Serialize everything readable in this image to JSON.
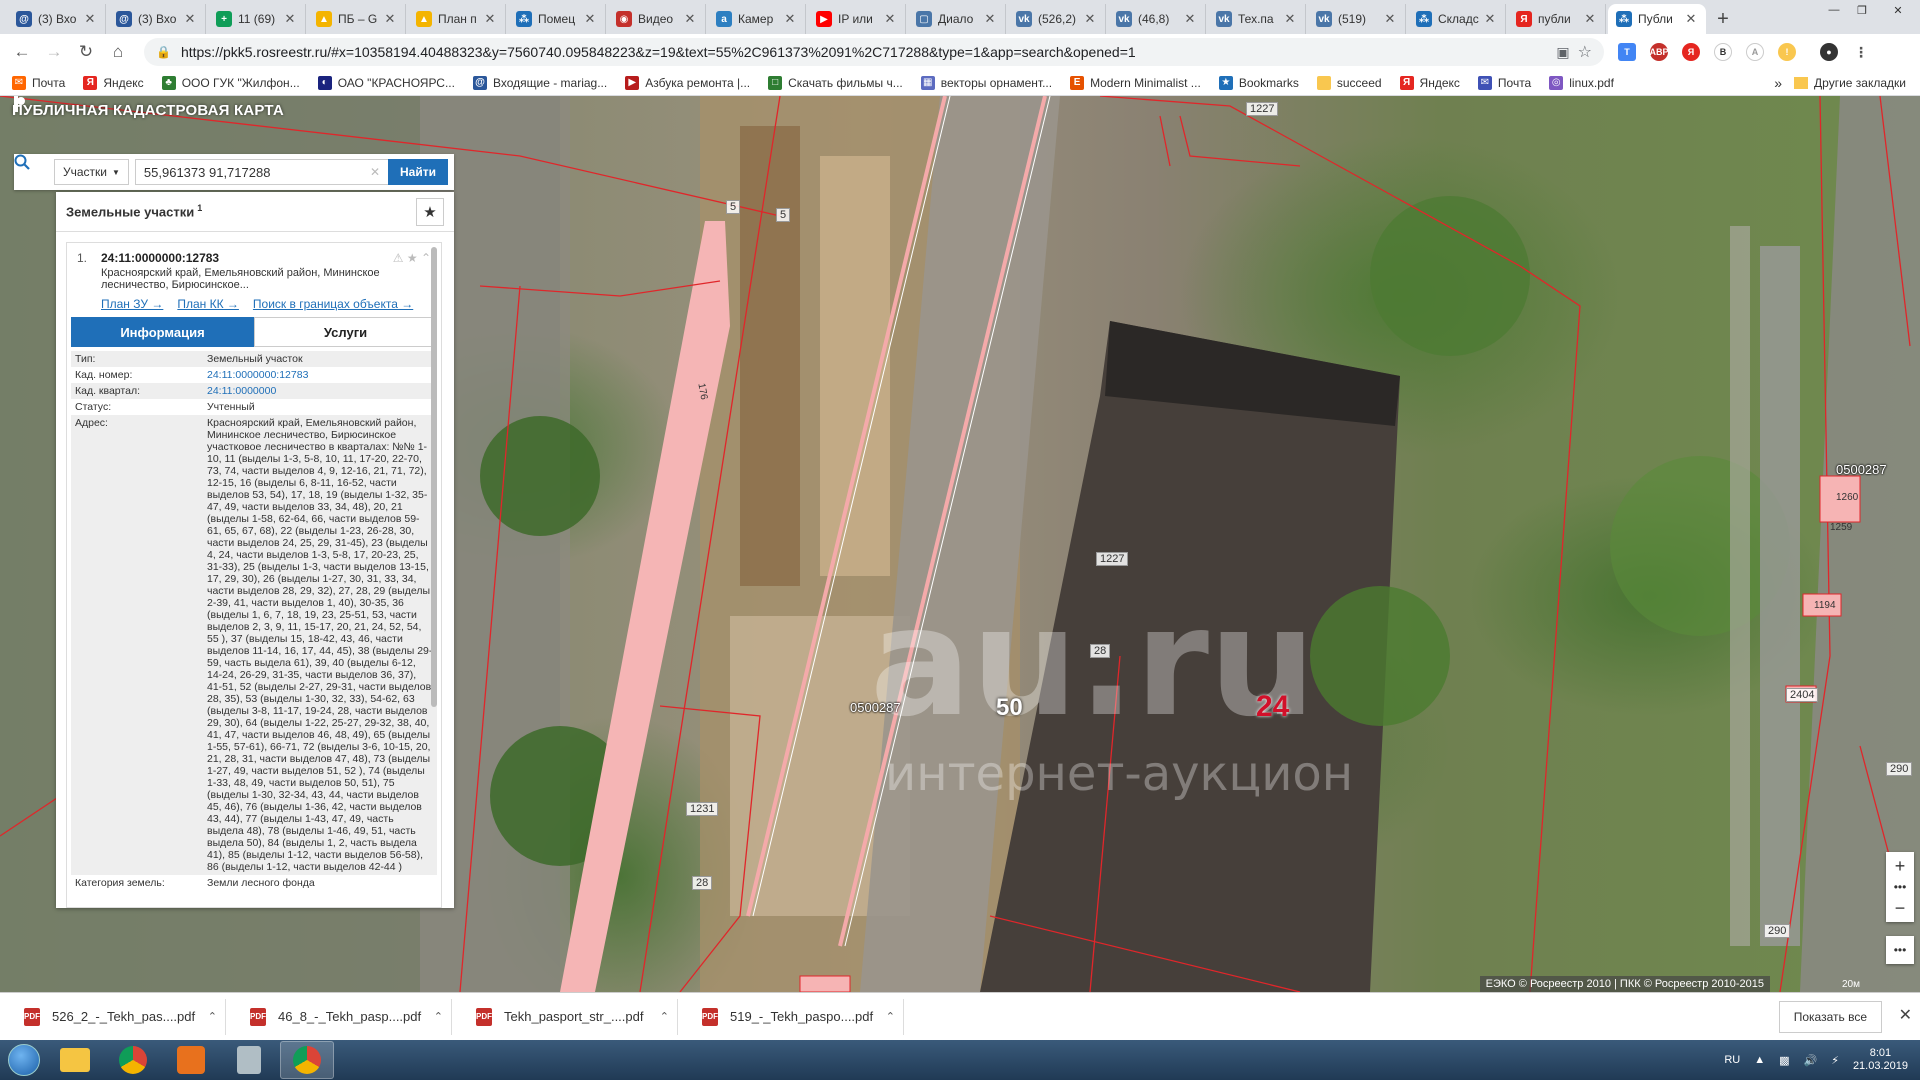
{
  "browser": {
    "tabs": [
      {
        "label": "(3) Вхо",
        "color": "#2b579a",
        "glyph": "@"
      },
      {
        "label": "(3) Вхо",
        "color": "#2b579a",
        "glyph": "@"
      },
      {
        "label": "11 (69)",
        "color": "#0f9d58",
        "glyph": "+"
      },
      {
        "label": "ПБ – G",
        "color": "#f4b400",
        "glyph": "▲"
      },
      {
        "label": "План п",
        "color": "#f4b400",
        "glyph": "▲"
      },
      {
        "label": "Помец",
        "color": "#1f6fb8",
        "glyph": "⁂"
      },
      {
        "label": "Видео",
        "color": "#c4302b",
        "glyph": "◉"
      },
      {
        "label": "Камер",
        "color": "#2d7fc1",
        "glyph": "a"
      },
      {
        "label": "IP или",
        "color": "#ff0000",
        "glyph": "▶"
      },
      {
        "label": "Диало",
        "color": "#4a76a8",
        "glyph": "▢"
      },
      {
        "label": "(526,2)",
        "color": "#4a76a8",
        "glyph": "vk"
      },
      {
        "label": "(46,8)",
        "color": "#4a76a8",
        "glyph": "vk"
      },
      {
        "label": "Тех.па",
        "color": "#4a76a8",
        "glyph": "vk"
      },
      {
        "label": "(519)",
        "color": "#4a76a8",
        "glyph": "vk"
      },
      {
        "label": "Складс",
        "color": "#1f6fb8",
        "glyph": "⁂"
      },
      {
        "label": "публи",
        "color": "#e52620",
        "glyph": "Я"
      },
      {
        "label": "Публи",
        "color": "#1f6fb8",
        "glyph": "⁂",
        "active": true
      }
    ],
    "url": "https://pkk5.rosreestr.ru/#x=10358194.40488323&y=7560740.095848223&z=19&text=55%2C961373%2091%2C717288&type=1&app=search&opened=1",
    "bookmarks": [
      {
        "label": "Почта",
        "color": "#ff6600",
        "glyph": "✉"
      },
      {
        "label": "Яндекс",
        "color": "#e52620",
        "glyph": "Я"
      },
      {
        "label": "ООО ГУК \"Жилфон...",
        "color": "#2e7d32",
        "glyph": "♣"
      },
      {
        "label": "ОАО \"КРАСНОЯРС...",
        "color": "#1a237e",
        "glyph": "◐"
      },
      {
        "label": "Входящие - mariag...",
        "color": "#2b579a",
        "glyph": "@"
      },
      {
        "label": "Азбука ремонта |...",
        "color": "#b71c1c",
        "glyph": "▶"
      },
      {
        "label": "Скачать фильмы ч...",
        "color": "#2e7d32",
        "glyph": "□"
      },
      {
        "label": "векторы орнамент...",
        "color": "#5c6bc0",
        "glyph": "▦"
      },
      {
        "label": "Modern Minimalist ...",
        "color": "#e65100",
        "glyph": "E"
      },
      {
        "label": "Bookmarks",
        "color": "#1f6fb8",
        "glyph": "★"
      },
      {
        "label": "succeed",
        "color": "#f9c74f",
        "glyph": " "
      },
      {
        "label": "Яндекс",
        "color": "#e52620",
        "glyph": "Я"
      },
      {
        "label": "Почта",
        "color": "#3f51b5",
        "glyph": "✉"
      },
      {
        "label": "linux.pdf",
        "color": "#7e57c2",
        "glyph": "◎"
      }
    ],
    "other_bookmarks": "Другие закладки"
  },
  "map": {
    "title": "ПУБЛИЧНАЯ КАДАСТРОВАЯ КАРТА",
    "search": {
      "type_label": "Участки",
      "value": "55,961373 91,717288",
      "button": "Найти"
    },
    "panel": {
      "title": "Земельные участки",
      "count": "1",
      "result": {
        "index": "1.",
        "kad_number": "24:11:0000000:12783",
        "address_short": "Красноярский край, Емельяновский район, Мининское лесничество, Бирюсинское...",
        "links": [
          "План ЗУ →",
          "План КК →",
          "Поиск в границах объекта →"
        ]
      },
      "tabs": [
        "Информация",
        "Услуги"
      ],
      "props": [
        {
          "k": "Тип:",
          "v": "Земельный участок",
          "link": false
        },
        {
          "k": "Кад. номер:",
          "v": "24:11:0000000:12783",
          "link": true
        },
        {
          "k": "Кад. квартал:",
          "v": "24:11:0000000",
          "link": true
        },
        {
          "k": "Статус:",
          "v": "Учтенный",
          "link": false
        },
        {
          "k": "Адрес:",
          "v": "Красноярский край, Емельяновский район, Мининское лесничество, Бирюсинское участковое лесничество в кварталах: №№ 1-10, 11 (выделы 1-3, 5-8, 10, 11, 17-20, 22-70, 73, 74, части выделов 4, 9, 12-16, 21, 71, 72), 12-15, 16 (выделы 6, 8-11, 16-52, части выделов 53, 54), 17, 18, 19 (выделы 1-32, 35-47, 49, части выделов 33, 34, 48), 20, 21 (выделы 1-58, 62-64, 66, части выделов 59-61, 65, 67, 68), 22 (выделы 1-23, 26-28, 30, части выделов 24, 25, 29, 31-45), 23 (выделы 4, 24, части выделов 1-3, 5-8, 17, 20-23, 25, 31-33), 25 (выделы 1-3, части выделов 13-15, 17, 29, 30), 26 (выделы 1-27, 30, 31, 33, 34, части выделов 28, 29, 32), 27, 28, 29 (выделы 2-39, 41, части выделов 1, 40), 30-35, 36 (выделы 1, 6, 7, 18, 19, 23, 25-51, 53, части выделов 2, 3, 9, 11, 15-17, 20, 21, 24, 52, 54, 55 ), 37 (выделы 15, 18-42, 43, 46, части выделов 11-14, 16, 17, 44, 45), 38 (выделы 29-59, часть выдела 61), 39, 40 (выделы 6-12, 14-24, 26-29, 31-35, части выделов 36, 37), 41-51, 52 (выделы 2-27, 29-31, части выделов 28, 35), 53 (выделы 1-30, 32, 33), 54-62, 63 (выделы 3-8, 11-17, 19-24, 28, части выделов 29, 30), 64 (выделы 1-22, 25-27, 29-32, 38, 40, 41, 47, части выделов 46, 48, 49), 65 (выделы 1-55, 57-61), 66-71, 72 (выделы 3-6, 10-15, 20, 21, 28, 31, части выделов 47, 48), 73 (выделы 1-27, 49, части выделов 51, 52 ), 74 (выделы 1-33, 48, 49, части выделов 50, 51), 75 (выделы 1-30, 32-34, 43, 44, части выделов 45, 46), 76 (выделы 1-36, 42, части выделов 43, 44), 77 (выделы 1-43, 47, 49, часть выдела 48), 78 (выделы 1-46, 49, 51, часть выдела 50), 84 (выделы 1, 2, часть выдела 41), 85 (выделы 1-12, части выделов 56-58), 86 (выделы 1-12, части выделов 42-44 )",
          "link": false
        },
        {
          "k": "Категория земель:",
          "v": "Земли лесного фонда",
          "link": false
        }
      ]
    },
    "labels": {
      "q24": "24",
      "q50": "50",
      "quarter": "0500287",
      "quarter_right": "0500287",
      "plots": [
        "1227",
        "1227",
        "28",
        "1231",
        "28",
        "5",
        "5",
        "176",
        "1260",
        "1259",
        "1194",
        "2404",
        "290",
        "290"
      ],
      "watermark_main": "au.ru",
      "watermark_sub": "интернет-аукцион",
      "copyright": "ЕЭКО © Росреестр 2010 | ПКК © Росреестр 2010-2015",
      "scale": "20м"
    }
  },
  "downloads": {
    "items": [
      "526_2_-_Tekh_pas....pdf",
      "46_8_-_Tekh_pasp....pdf",
      "Tekh_pasport_str_....pdf",
      "519_-_Tekh_paspo....pdf"
    ],
    "show_all": "Показать все"
  },
  "taskbar": {
    "lang": "RU",
    "time": "8:01",
    "date": "21.03.2019"
  }
}
